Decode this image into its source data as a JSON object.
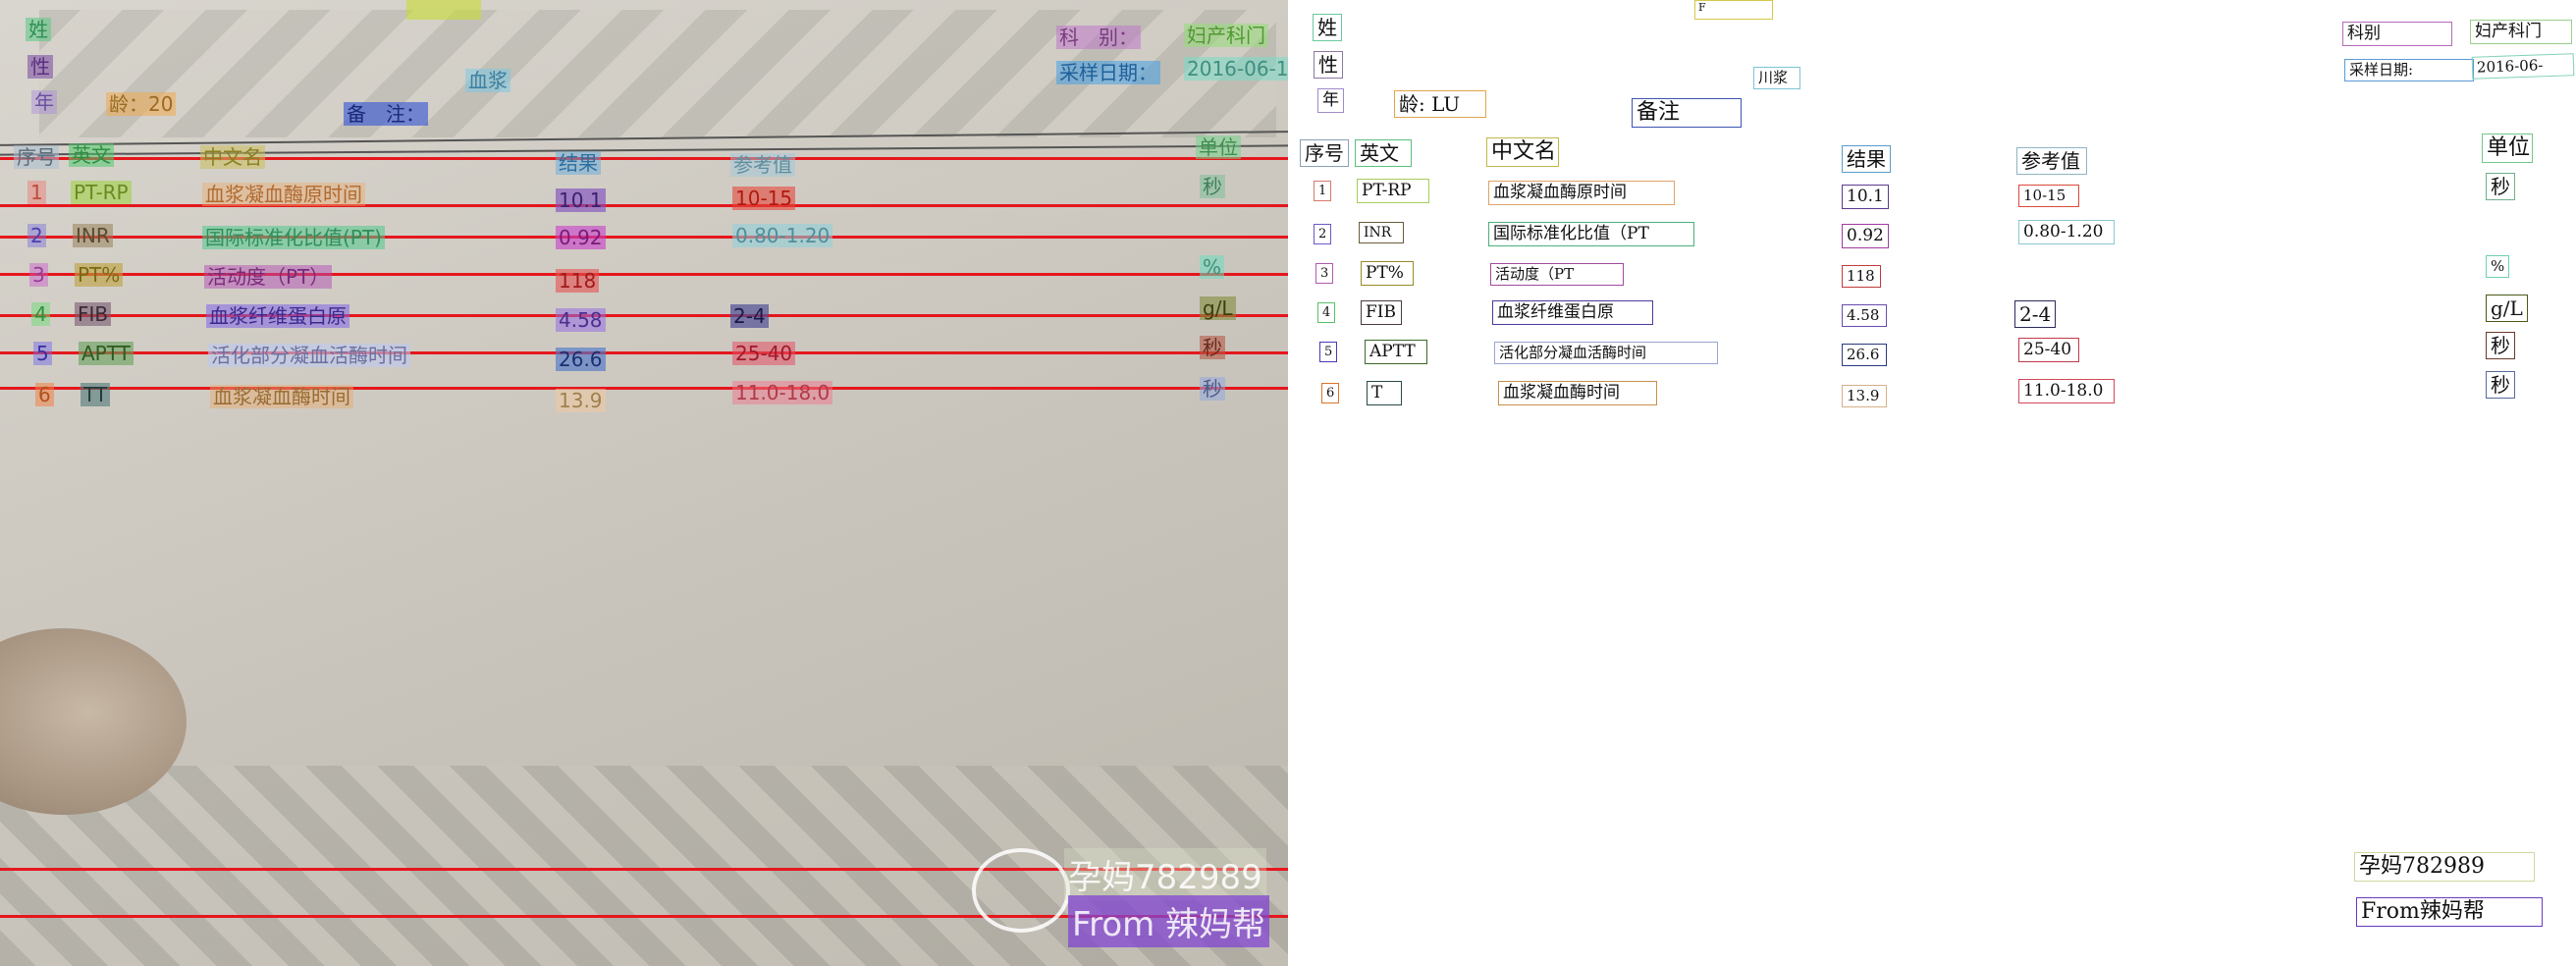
{
  "photo": {
    "header": {
      "name_char": "姓",
      "gender_char": "性",
      "age_label": "年",
      "age_value": "龄：20",
      "note_label": "备　注：",
      "sample": "血浆",
      "dept_label": "科　别：",
      "dept_value": "妇产科门",
      "date_label": "采样日期：",
      "date_value": "2016-06-1"
    },
    "columns": [
      "序号",
      "英文",
      "中文名",
      "结果",
      "参考值",
      "单位"
    ],
    "rows": [
      {
        "no": "1",
        "en": "PT-RP",
        "cn": "血浆凝血酶原时间",
        "result": "10.1",
        "ref": "10-15",
        "unit": "秒"
      },
      {
        "no": "2",
        "en": "INR",
        "cn": "国际标准化比值(PT)",
        "result": "0.92",
        "ref": "0.80-1.20",
        "unit": ""
      },
      {
        "no": "3",
        "en": "PT%",
        "cn": "活动度（PT）",
        "result": "118",
        "ref": "",
        "unit": "%"
      },
      {
        "no": "4",
        "en": "FIB",
        "cn": "血浆纤维蛋白原",
        "result": "4.58",
        "ref": "2-4",
        "unit": "g/L"
      },
      {
        "no": "5",
        "en": "APTT",
        "cn": "活化部分凝血活酶时间",
        "result": "26.6",
        "ref": "25-40",
        "unit": "秒"
      },
      {
        "no": "6",
        "en": "TT",
        "cn": "血浆凝血酶时间",
        "result": "13.9",
        "ref": "11.0-18.0",
        "unit": "秒"
      }
    ],
    "watermark": {
      "line1": "孕妈782989",
      "line2": "From 辣妈帮"
    }
  },
  "panel": {
    "header": {
      "name_char": "姓",
      "top_mark": "F",
      "dept_label": "科别",
      "dept_value": "妇产科门",
      "gender_char": "性",
      "sample": "川浆",
      "date_label": "采样日期:",
      "date_value": "2016-06-",
      "age_label": "年",
      "age_value": "龄: LU",
      "note_label": "备注"
    },
    "columns": [
      "序号",
      "英文",
      "中文名",
      "结果",
      "参考值",
      "单位"
    ],
    "rows": [
      {
        "no": "1",
        "en": "PT-RP",
        "cn": "血浆凝血酶原时间",
        "result": "10.1",
        "ref": "10-15",
        "unit": "秒"
      },
      {
        "no": "2",
        "en": "INR",
        "cn": "国际标准化比值（PT",
        "result": "0.92",
        "ref": "0.80-1.20",
        "unit": ""
      },
      {
        "no": "3",
        "en": "PT%",
        "cn": "活动度（PT",
        "result": "118",
        "ref": "",
        "unit": "%"
      },
      {
        "no": "4",
        "en": "FIB",
        "cn": "血浆纤维蛋白原",
        "result": "4.58",
        "ref": "2-4",
        "unit": "g/L"
      },
      {
        "no": "5",
        "en": "APTT",
        "cn": "活化部分凝血活酶时间",
        "result": "26.6",
        "ref": "25-40",
        "unit": "秒"
      },
      {
        "no": "6",
        "en": "T",
        "cn": "血浆凝血酶时间",
        "result": "13.9",
        "ref": "11.0-18.0",
        "unit": "秒"
      }
    ],
    "watermark": {
      "line1": "孕妈782989",
      "line2": "From辣妈帮"
    }
  }
}
